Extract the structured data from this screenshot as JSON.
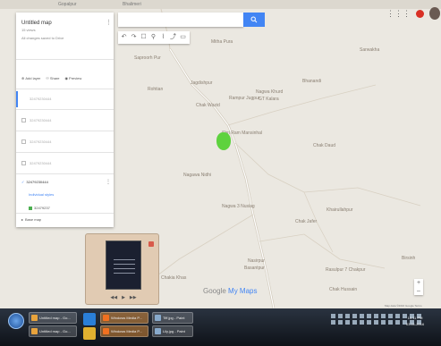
{
  "top_strip": {
    "labels": [
      "Gopalpur",
      "Bhalimeri"
    ]
  },
  "search": {
    "placeholder": ""
  },
  "toolbar": {
    "tools": [
      "undo-icon",
      "redo-icon",
      "hand-icon",
      "marker-icon",
      "line-icon",
      "route-icon",
      "ruler-icon"
    ]
  },
  "header": {
    "icons": [
      "apps-icon",
      "notification-icon",
      "avatar"
    ]
  },
  "panel": {
    "title": "Untitled map",
    "views": "15 views",
    "saved": "All changes saved to Drive",
    "actions": {
      "add_layer": "Add layer",
      "share": "Share",
      "preview": "Preview"
    },
    "layers": [
      "32479230444",
      "32479230444",
      "32479230444",
      "32479230444"
    ],
    "active_layer": {
      "title": "32479230444",
      "style": "Individual styles",
      "item": "32479237"
    },
    "basemap": "Base map"
  },
  "map": {
    "places": [
      "Mitha Pura",
      "Saproorh Pur",
      "Bhanandi",
      "Sarwakha",
      "Rohtian",
      "Jagdishpur",
      "Nagwa Khurd",
      "Rampur Jugpur",
      "Chak Wazid",
      "GT Kalara",
      "Shri Ram Mansinhal",
      "Chak Daud",
      "Nagawa Nidhi",
      "Nagwa 3 Nusiag",
      "Khairullahpur",
      "Chak Jafer",
      "Nasirpur",
      "Birsinh",
      "Basantpur",
      "Rasulpur 7 Chakpur",
      "Chakia Khas",
      "Chak Hussain"
    ]
  },
  "branding": {
    "google": "Google",
    "my_maps": "My Maps"
  },
  "copyright": "Map data ©2016 Google  Terms",
  "zoom": {
    "in": "+",
    "out": "–"
  },
  "popup": {
    "thumb_lines": 4,
    "controls": [
      "◀◀",
      "▶",
      "▶▶"
    ]
  },
  "taskbar": {
    "tasks": [
      {
        "label": "Untitled map - Go..."
      },
      {
        "label": "Untitled map - Go..."
      },
      {
        "label": "Windows Media P..."
      },
      {
        "label": "Windows Media P..."
      },
      {
        "label": "Tiff.jpg - Paint"
      },
      {
        "label": "Lily.jpg - Paint"
      }
    ],
    "clock": {
      "time": "10:11 PM",
      "date": "03-11-2016"
    }
  },
  "colors": {
    "accent": "#4285f4",
    "polygon": "#5ed23e"
  }
}
